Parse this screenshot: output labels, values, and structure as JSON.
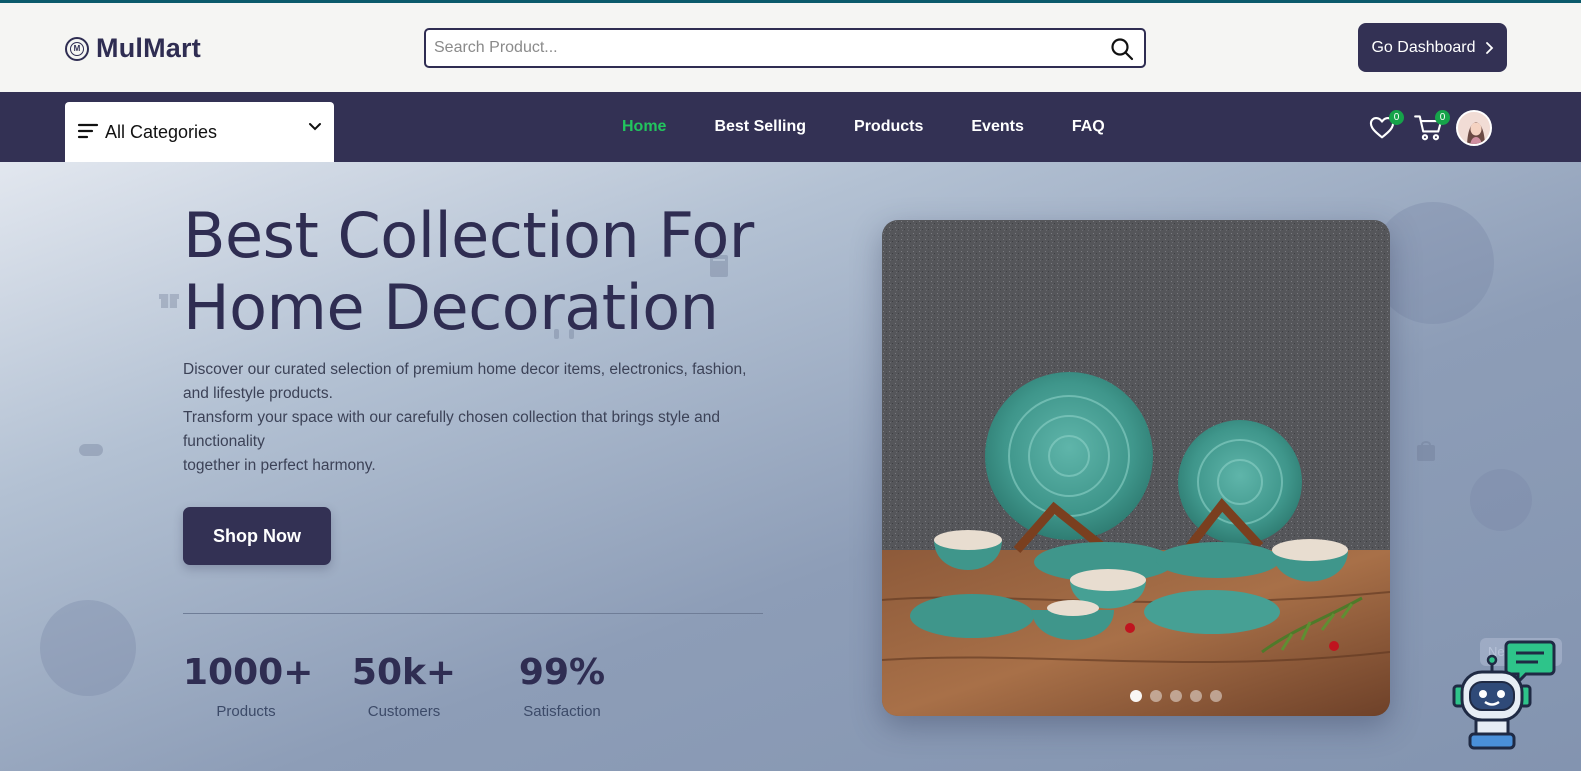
{
  "header": {
    "logo_text": "MulMart",
    "logo_mark": "M",
    "search_placeholder": "Search Product...",
    "dashboard_label": "Go Dashboard"
  },
  "nav": {
    "categories_label": "All Categories",
    "links": [
      {
        "label": "Home",
        "active": true
      },
      {
        "label": "Best Selling",
        "active": false
      },
      {
        "label": "Products",
        "active": false
      },
      {
        "label": "Events",
        "active": false
      },
      {
        "label": "FAQ",
        "active": false
      }
    ],
    "wishlist_count": "0",
    "cart_count": "0"
  },
  "hero": {
    "title_line1": "Best Collection For",
    "title_line2": "Home Decoration",
    "desc_line1": "Discover our curated selection of premium home decor items, electronics, fashion, and lifestyle products.",
    "desc_line2": "Transform your space with our carefully chosen collection that brings style and functionality",
    "desc_line3": "together in perfect harmony.",
    "cta_label": "Shop Now",
    "stats": [
      {
        "value": "1000+",
        "label": "Products"
      },
      {
        "value": "50k+",
        "label": "Customers"
      },
      {
        "value": "99%",
        "label": "Satisfaction"
      }
    ],
    "slider": {
      "slide_count": 5,
      "active_index": 0
    }
  },
  "chatbot": {
    "tooltip": "Need help?"
  },
  "colors": {
    "brand": "#333154",
    "active_link": "#22c55e",
    "badge": "#16a34a",
    "accent_line": "#0b5a6b"
  }
}
